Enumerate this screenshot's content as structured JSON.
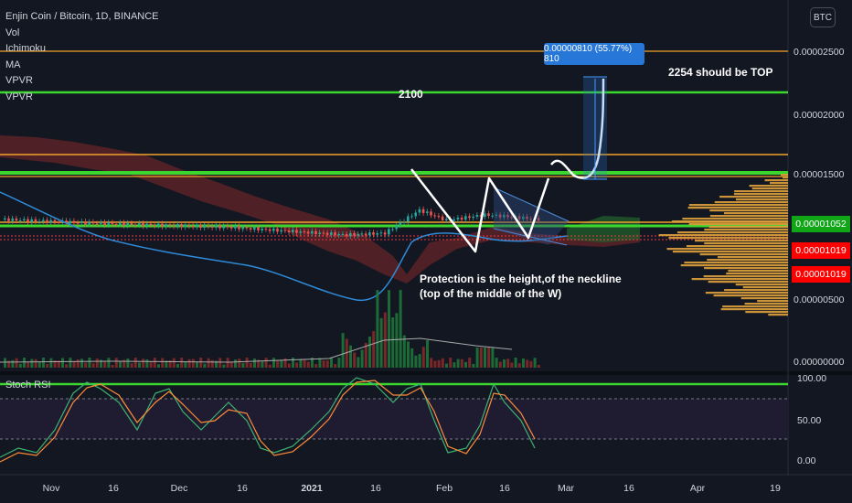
{
  "legend": {
    "title": "Enjin Coin / Bitcoin, 1D, BINANCE",
    "indicators": [
      "Vol",
      "Ichimoku",
      "MA",
      "VPVR",
      "VPVR"
    ]
  },
  "currency_badge": "BTC",
  "price_axis": [
    "0.00002500",
    "0.00002000",
    "0.00001500",
    "0.00000500",
    "0.00000000"
  ],
  "price_tags": {
    "current": "0.00001052",
    "marker_1": "0.00001019",
    "marker_2": "0.00001019"
  },
  "rsi_axis": [
    "100.00",
    "50.00",
    "0.00"
  ],
  "rsi_label": "Stoch RSI",
  "time_axis": [
    "Nov",
    "16",
    "Dec",
    "16",
    "2021",
    "16",
    "Feb",
    "16",
    "Mar",
    "16",
    "Apr",
    "19"
  ],
  "measure_label": "0.00000810 (55.77%) 810",
  "annotations": {
    "top_note": "2254 should be TOP",
    "level_note": "2100",
    "protection_line1": "Protection is the height,of the neckline",
    "protection_line2": "(top of the middle of the W)"
  },
  "colors": {
    "background": "#131722",
    "green_line": "#3bd72f",
    "orange_line": "#f2a32b",
    "red_dotted": "#f23645",
    "candle_up": "#26a69a",
    "candle_down": "#ef5350",
    "ma": "#2f8bd8",
    "cloud": "#6b2a2e",
    "measure": "#2677d8",
    "current_tag": "#11a518",
    "marker_tag": "#ff0000"
  }
}
